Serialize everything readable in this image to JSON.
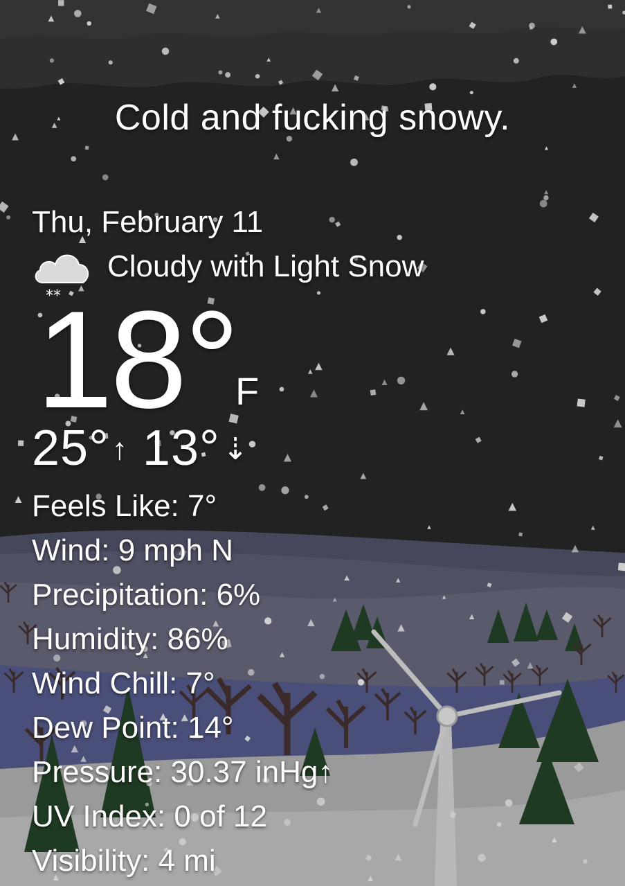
{
  "tagline": "Cold and fucking snowy.",
  "date": "Thu, February 11",
  "condition": {
    "icon": "cloud-snow-icon",
    "text": "Cloudy with Light Snow"
  },
  "temperature": {
    "current": "18°",
    "unit": "F",
    "high": "25°",
    "high_arrow": "↑",
    "low": "13°",
    "low_arrow": "⇣"
  },
  "details": [
    "Feels Like: 7°",
    "Wind: 9 mph N",
    "Precipitation: 6%",
    "Humidity: 86%",
    "Wind Chill: 7°",
    "Dew Point: 14°",
    "Pressure: 30.37 inHg↑",
    "UV Index: 0 of 12",
    "Visibility: 4 mi"
  ],
  "colors": {
    "sky": "#222222",
    "cloud_band": "#2e2e2e",
    "distant_hills": "#4a4c5e",
    "mid_hills": "#595a6c",
    "snow_ground": "#9c9c9c",
    "pine": "#1f3a22",
    "text": "#ffffff"
  }
}
